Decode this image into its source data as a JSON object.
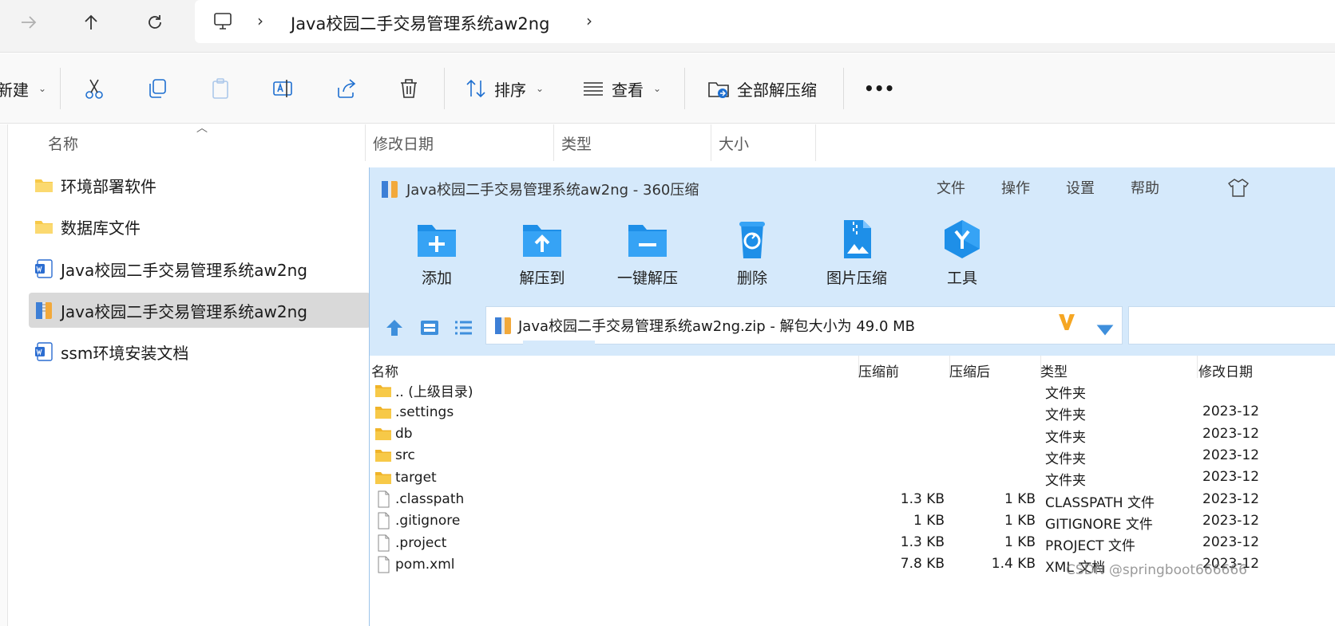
{
  "explorer": {
    "nav": {
      "forward_icon": "arrow-right-icon",
      "up_icon": "arrow-up-icon",
      "refresh_icon": "refresh-icon"
    },
    "address": {
      "crumb": "Java校园二手交易管理系统aw2ng"
    },
    "toolbar": {
      "new_label": "新建",
      "sort_label": "排序",
      "view_label": "查看",
      "extract_all_label": "全部解压缩",
      "more_label": "•••"
    },
    "columns": [
      "名称",
      "修改日期",
      "类型",
      "大小"
    ],
    "files": [
      {
        "name": "环境部署软件",
        "icon": "folder-icon"
      },
      {
        "name": "数据库文件",
        "icon": "folder-icon"
      },
      {
        "name": "Java校园二手交易管理系统aw2ng",
        "icon": "word-doc-icon"
      },
      {
        "name": "Java校园二手交易管理系统aw2ng",
        "icon": "zip-archive-icon",
        "selected": true
      },
      {
        "name": "ssm环境安装文档",
        "icon": "word-doc-icon"
      }
    ]
  },
  "zip": {
    "title": "Java校园二手交易管理系统aw2ng - 360压缩",
    "menu": [
      "文件",
      "操作",
      "设置",
      "帮助"
    ],
    "tools": [
      "添加",
      "解压到",
      "一键解压",
      "删除",
      "图片压缩",
      "工具"
    ],
    "path": "Java校园二手交易管理系统aw2ng.zip - 解包大小为 49.0 MB",
    "columns": [
      "名称",
      "压缩前",
      "压缩后",
      "类型",
      "修改日期"
    ],
    "rows": [
      {
        "name": ".. (上级目录)",
        "before": "",
        "after": "",
        "type": "文件夹",
        "date": "",
        "icon": "folder"
      },
      {
        "name": ".settings",
        "before": "",
        "after": "",
        "type": "文件夹",
        "date": "2023-12",
        "icon": "folder"
      },
      {
        "name": "db",
        "before": "",
        "after": "",
        "type": "文件夹",
        "date": "2023-12",
        "icon": "folder"
      },
      {
        "name": "src",
        "before": "",
        "after": "",
        "type": "文件夹",
        "date": "2023-12",
        "icon": "folder"
      },
      {
        "name": "target",
        "before": "",
        "after": "",
        "type": "文件夹",
        "date": "2023-12",
        "icon": "folder"
      },
      {
        "name": ".classpath",
        "before": "1.3 KB",
        "after": "1 KB",
        "type": "CLASSPATH 文件",
        "date": "2023-12",
        "icon": "file"
      },
      {
        "name": ".gitignore",
        "before": "1 KB",
        "after": "1 KB",
        "type": "GITIGNORE 文件",
        "date": "2023-12",
        "icon": "file"
      },
      {
        "name": ".project",
        "before": "1.3 KB",
        "after": "1 KB",
        "type": "PROJECT 文件",
        "date": "2023-12",
        "icon": "file"
      },
      {
        "name": "pom.xml",
        "before": "7.8 KB",
        "after": "1.4 KB",
        "type": "XML 文档",
        "date": "2023-12",
        "icon": "file"
      }
    ]
  },
  "watermark": "CSDN @springboot666666",
  "colors": {
    "zip_bg": "#d5e9fb",
    "folder_yellow": "#f7c948",
    "zip_blue": "#1e8fe8",
    "selected_row": "#d9d9d9"
  }
}
